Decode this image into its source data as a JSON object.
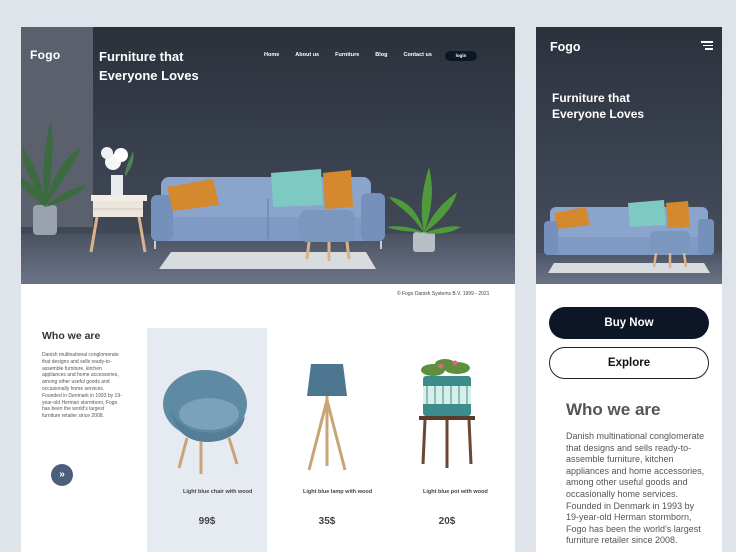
{
  "desktop": {
    "logo": "Fogo",
    "tagline": "Furniture that Everyone Loves",
    "nav": [
      "Home",
      "About us",
      "Furniture",
      "Blog",
      "Contact us"
    ],
    "login_label": "login",
    "copyright": "© Fogo Danish Systems B.V. 1999 - 2021",
    "who_title": "Who we are",
    "who_text": "Danish multinational conglomerate that designs and sells ready-to-assemble furniture, kitchen appliances and home accessories, among other useful goods and occasionally home services. Founded in Denmark in 1993 by 19-year-old Herman stormborn, Fogo has been the world's largest furniture retailer since 2008.",
    "arrow_label": "»",
    "products": [
      {
        "name": "Light blue chair with wood",
        "price": "99$"
      },
      {
        "name": "Light blue lamp with wood",
        "price": "35$"
      },
      {
        "name": "Light blue pot with wood",
        "price": "20$"
      }
    ]
  },
  "mobile": {
    "logo": "Fogo",
    "tagline": "Furniture that Everyone Loves",
    "buy_label": "Buy Now",
    "explore_label": "Explore",
    "who_title": "Who we are",
    "who_text": "Danish multinational conglomerate that designs and sells ready-to-assemble furniture, kitchen appliances and home accessories, among other useful goods and occasionally home services. Founded in Denmark in 1993 by 19-year-old Herman stormborn, Fogo has been the world's largest furniture retailer since 2008."
  },
  "colors": {
    "accent_dark": "#0d1626",
    "sofa": "#7f9ac4",
    "pillow_orange": "#d4892e",
    "pillow_teal": "#7fc9c4",
    "highlight_card": "#e6ebf2",
    "arrow_button": "#4c5e7c"
  },
  "icons": [
    "menu-icon",
    "double-chevron-right-icon"
  ]
}
